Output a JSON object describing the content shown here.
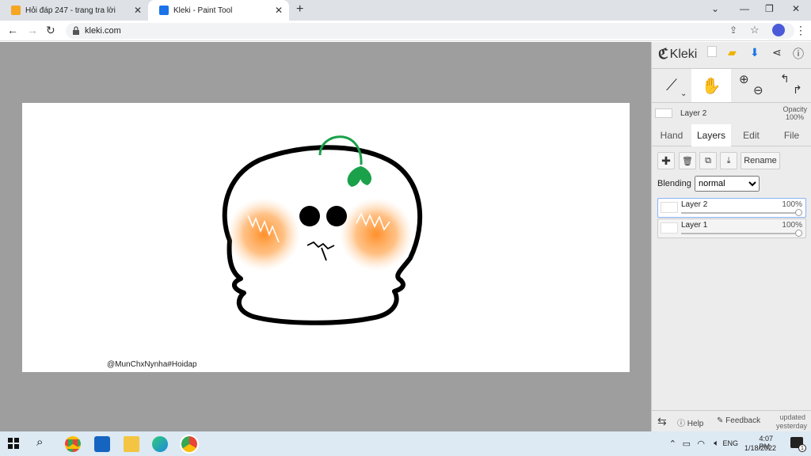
{
  "browser": {
    "tabs": [
      {
        "title": "Hỏi đáp 247 - trang tra lời",
        "close": "✕"
      },
      {
        "title": "Kleki - Paint Tool",
        "close": "✕"
      }
    ],
    "new_tab": "+",
    "url": "kleki.com"
  },
  "canvas": {
    "watermark": "@MunChxNynha#Hoidap"
  },
  "panel": {
    "brand": "Kleki",
    "current_layer": "Layer 2",
    "opacity_label": "Opacity",
    "opacity_value": "100%",
    "tabs": [
      "Hand",
      "Layers",
      "Edit",
      "File"
    ],
    "active_tab": "Layers",
    "rename_label": "Rename",
    "blending_label": "Blending",
    "blending_value": "normal",
    "layers": [
      {
        "name": "Layer 2",
        "opacity": "100%"
      },
      {
        "name": "Layer 1",
        "opacity": "100%"
      }
    ],
    "help_label": "Help",
    "feedback_label": "Feedback",
    "updated_line1": "updated",
    "updated_line2": "yesterday"
  },
  "taskbar": {
    "lang": "ENG",
    "time": "4:07 PM",
    "date": "1/18/2022",
    "notif_count": "1"
  },
  "colors": {
    "leaf": "#1aa14a",
    "blush": "#ff9a3c",
    "accent": "#1a73e8"
  }
}
